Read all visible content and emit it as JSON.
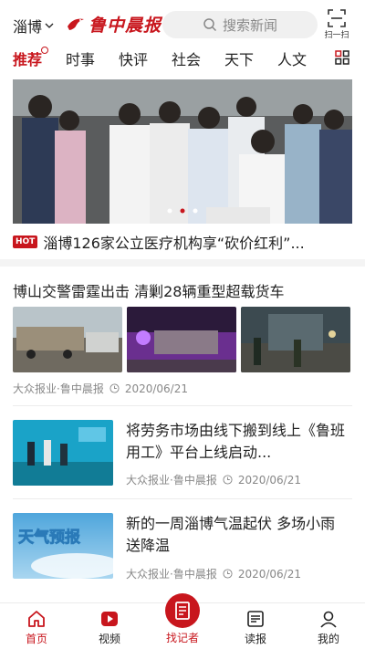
{
  "header": {
    "city": "淄博",
    "logo_text": "鲁中晨报",
    "search_placeholder": "搜索新闻",
    "scan_label": "扫一扫"
  },
  "tabs": [
    "推荐",
    "时事",
    "快评",
    "社会",
    "天下",
    "人文"
  ],
  "hero": {
    "hot_badge": "HOT",
    "title": "淄博126家公立医疗机构享“砍价红利”..."
  },
  "news": [
    {
      "title": "博山交警雷霆出击 清剿28辆重型超载货车",
      "source": "大众报业·鲁中晨报",
      "date": "2020/06/21"
    },
    {
      "title": "将劳务市场由线下搬到线上《鲁班用工》平台上线启动...",
      "source": "大众报业·鲁中晨报",
      "date": "2020/06/21"
    },
    {
      "title": "新的一周淄博气温起伏 多场小雨送降温",
      "source": "大众报业·鲁中晨报",
      "date": "2020/06/21",
      "thumb_text": "天气预报"
    }
  ],
  "bottom_nav": {
    "home": "首页",
    "video": "视频",
    "reporter": "找记者",
    "read": "读报",
    "mine": "我的"
  },
  "colors": {
    "brand": "#c8161d"
  }
}
